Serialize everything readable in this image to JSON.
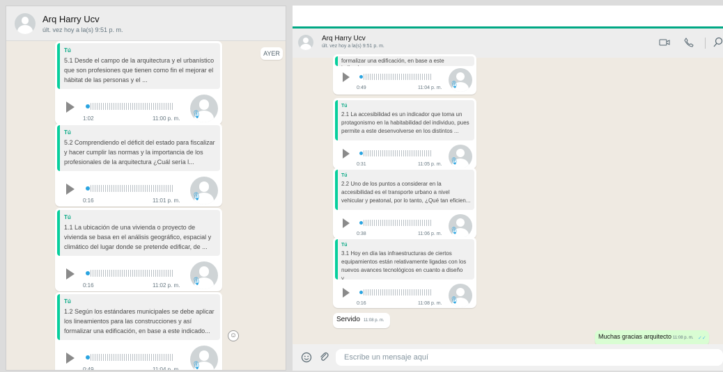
{
  "left": {
    "contact_name": "Arq Harry Ucv",
    "status": "últ. vez hoy a la(s) 9:51 p. m.",
    "day_label": "AYER",
    "messages": [
      {
        "author": "Tú",
        "text": "5.1 Desde el campo de la arquitectura y el urbanístico que son profesiones que tienen como fin el mejorar el hábitat de las personas y el ...",
        "duration": "1:02",
        "time": "11:00 p. m."
      },
      {
        "author": "Tú",
        "text": "5.2 Comprendiendo el déficit del estado para fiscalizar y hacer cumplir las normas y la importancia de los profesionales de la arquitectura ¿Cuál sería l...",
        "duration": "0:16",
        "time": "11:01 p. m."
      },
      {
        "author": "Tú",
        "text": "1.1 La ubicación de una vivienda o proyecto de vivienda se basa en el análisis geográfico, espacial y climático del lugar donde se pretende edificar, de ...",
        "duration": "0:16",
        "time": "11:02 p. m."
      },
      {
        "author": "Tú",
        "text": "1.2 Según los estándares municipales se debe aplicar los lineamientos para las construcciones y así formalizar una edificación, en base a este indicado...",
        "duration": "0:49",
        "time": "11:04 p. m."
      }
    ]
  },
  "right": {
    "contact_name": "Arq Harry Ucv",
    "status": "últ. vez hoy a la(s) 9:51 p. m.",
    "partial_quote": "formalizar una edificación, en base a este indicado...",
    "first_audio": {
      "duration": "0:49",
      "time": "11:04 p. m."
    },
    "messages": [
      {
        "author": "Tú",
        "text": "2.1 La accesibilidad es un indicador que toma un protagonismo en la habitabilidad del individuo, pues permite a este desenvolverse en los distintos ...",
        "duration": "0:31",
        "time": "11:05 p. m."
      },
      {
        "author": "Tú",
        "text": "2.2 Uno de los puntos a considerar en la accesibilidad es el transporte urbano a nivel vehicular y peatonal, por lo tanto, ¿Qué tan eficien...",
        "duration": "0:38",
        "time": "11:06 p. m."
      },
      {
        "author": "Tú",
        "text": "3.1 Hoy en día las infraestructuras de ciertos equipamientos están relativamente ligadas con los nuevos avances tecnológicos en cuanto a diseño y...",
        "duration": "0:16",
        "time": "11:08 p. m."
      }
    ],
    "incoming": {
      "text": "Servido",
      "time": "11:08 p. m."
    },
    "outgoing": {
      "text": "Muchas gracias arquitecto",
      "time": "11:08 p. m.",
      "ticks": "✓✓"
    },
    "input_placeholder": "Escribe un mensaje aquí",
    "colors": {
      "outgoing_bubble": "#d9fdd3",
      "quote_accent": "#06cf9c",
      "audio_dot": "#2aa4e0",
      "header_accent": "#00a884"
    }
  }
}
